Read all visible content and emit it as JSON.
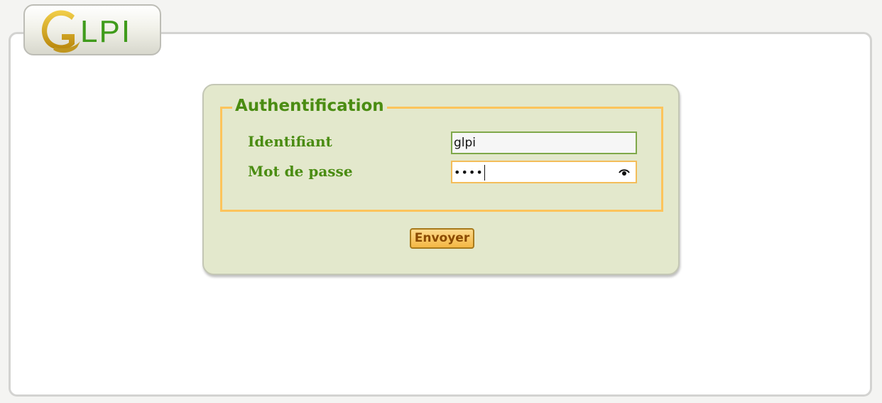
{
  "logo": {
    "text": "LPI",
    "full": "GLPI",
    "colors": {
      "green": "#3f9b1b",
      "gold": "#d6a21a"
    }
  },
  "login": {
    "legend": "Authentification",
    "username_label": "Identifiant",
    "username_value": "glpi",
    "password_label": "Mot de passe",
    "password_masked": "••••",
    "submit_label": "Envoyer",
    "reveal_icon": "eye-icon"
  },
  "colors": {
    "panel_bg": "#e3e8cc",
    "fieldset_border": "#fdc45c",
    "label_green": "#4a8c12",
    "button_orange": "#f4b744"
  }
}
